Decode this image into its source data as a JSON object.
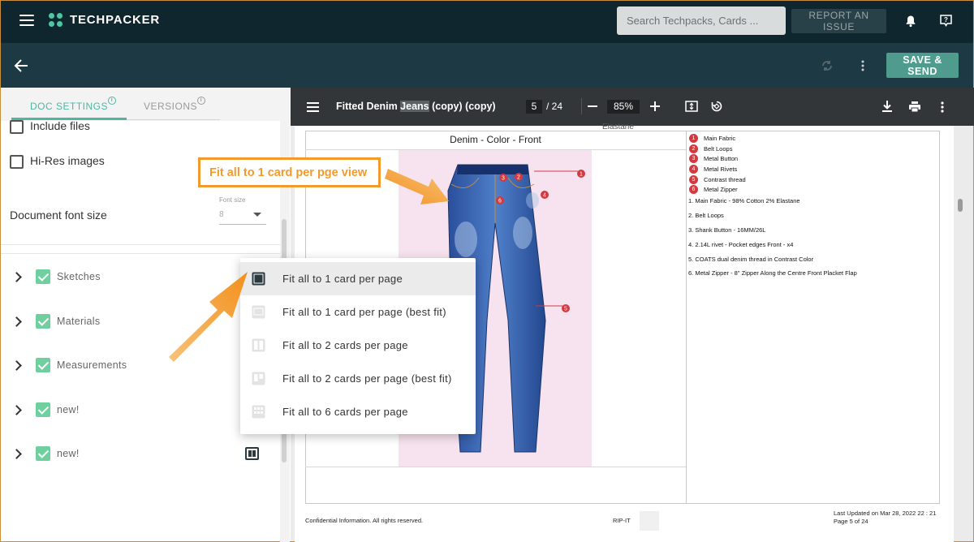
{
  "header": {
    "brand": "TECHPACKER",
    "search_placeholder": "Search Techpacks, Cards ...",
    "report_label": "REPORT AN ISSUE",
    "save_send_label": "SAVE & SEND"
  },
  "left_panel": {
    "tabs": [
      {
        "label": "DOC SETTINGS",
        "active": true
      },
      {
        "label": "VERSIONS",
        "active": false
      }
    ],
    "options": [
      {
        "label": "Include files",
        "checked": false
      },
      {
        "label": "Hi-Res images",
        "checked": false
      }
    ],
    "font_size": {
      "label": "Document font size",
      "caption": "Font size",
      "value": "8"
    },
    "sections": [
      {
        "label": "Sketches",
        "checked": true
      },
      {
        "label": "Materials",
        "checked": true
      },
      {
        "label": "Measurements",
        "checked": true
      },
      {
        "label": "new!",
        "checked": true
      },
      {
        "label": "new!",
        "checked": true
      }
    ]
  },
  "layout_menu": {
    "selected_index": 0,
    "items": [
      "Fit all to 1 card per page",
      "Fit all to 1 card per page (best fit)",
      "Fit all to 2 cards per page",
      "Fit all to 2 cards per page (best fit)",
      "Fit all to 6 cards per page"
    ]
  },
  "annotation": {
    "text": "Fit all to 1 card per pge view",
    "color": "#f39a2c"
  },
  "viewer": {
    "title_before": "Fitted Denim ",
    "title_highlight": "Jeans",
    "title_after": " (copy) (copy)",
    "page_current": "5",
    "page_total": "/ 24",
    "zoom": "85%"
  },
  "document": {
    "cut_text": "Elastane",
    "card_title": "Denim - Color - Front",
    "callouts": [
      {
        "num": "1",
        "label": "Main Fabric"
      },
      {
        "num": "2",
        "label": "Belt Loops"
      },
      {
        "num": "3",
        "label": "Metal Button"
      },
      {
        "num": "4",
        "label": "Metal Rivets"
      },
      {
        "num": "5",
        "label": "Contrast thread"
      },
      {
        "num": "6",
        "label": "Metal Zipper"
      }
    ],
    "details": [
      "1. Main Fabric - 98% Cotton 2% Elastane",
      "2. Belt Loops",
      "3. Shank Button - 16MM/26L",
      "4. 2.14L rivet - Pocket edges Front - x4",
      "5. COATS dual denim thread in Contrast Color",
      "6. Metal Zipper - 8\" Zipper Along the Centre Front Placket Flap"
    ],
    "sketch_markers": [
      "1",
      "2",
      "3",
      "4",
      "5",
      "6"
    ],
    "footer_left": "Confidential Information. All rights reserved.",
    "footer_mid": "RIP-IT",
    "footer_right_1": "Last Updated on Mar 28, 2022 22 : 21",
    "footer_right_2": "Page 5 of 24"
  },
  "colors": {
    "accent": "#4fb6a2",
    "header": "#10262e",
    "subheader": "#1d3a44",
    "save": "#4f9c8e",
    "checkbox": "#6fcf9f",
    "marker": "#d3393f"
  }
}
